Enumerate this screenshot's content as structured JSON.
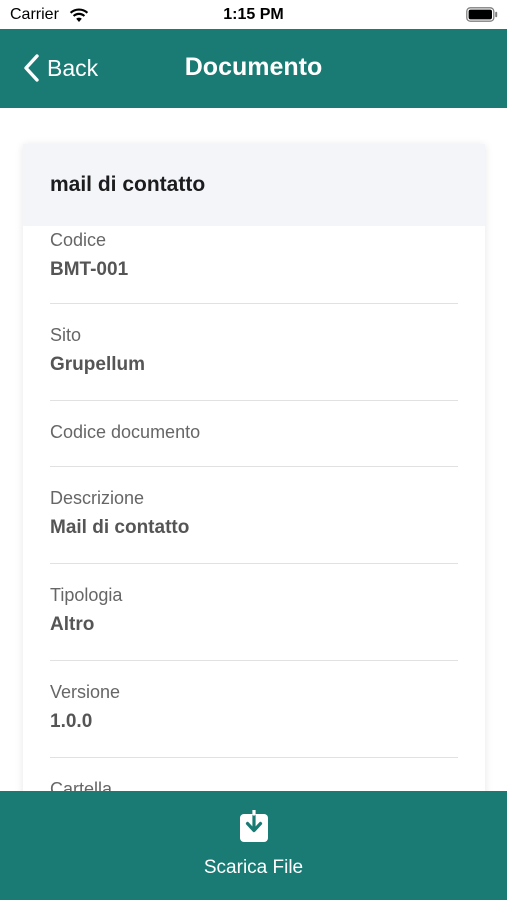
{
  "status_bar": {
    "carrier": "Carrier",
    "time": "1:15 PM"
  },
  "nav": {
    "back_label": "Back",
    "title": "Documento"
  },
  "card": {
    "title": "mail di contatto",
    "fields": [
      {
        "label": "Codice",
        "value": "BMT-001"
      },
      {
        "label": "Sito",
        "value": "Grupellum"
      },
      {
        "label": "Codice documento",
        "value": ""
      },
      {
        "label": "Descrizione",
        "value": "Mail di contatto"
      },
      {
        "label": "Tipologia",
        "value": "Altro"
      },
      {
        "label": "Versione",
        "value": "1.0.0"
      },
      {
        "label": "Cartella",
        "value": ""
      }
    ]
  },
  "bottom_bar": {
    "action_label": "Scarica File",
    "icon": "download-icon"
  },
  "colors": {
    "primary": "#1a7a74",
    "card_header": "#f3f5f8"
  }
}
